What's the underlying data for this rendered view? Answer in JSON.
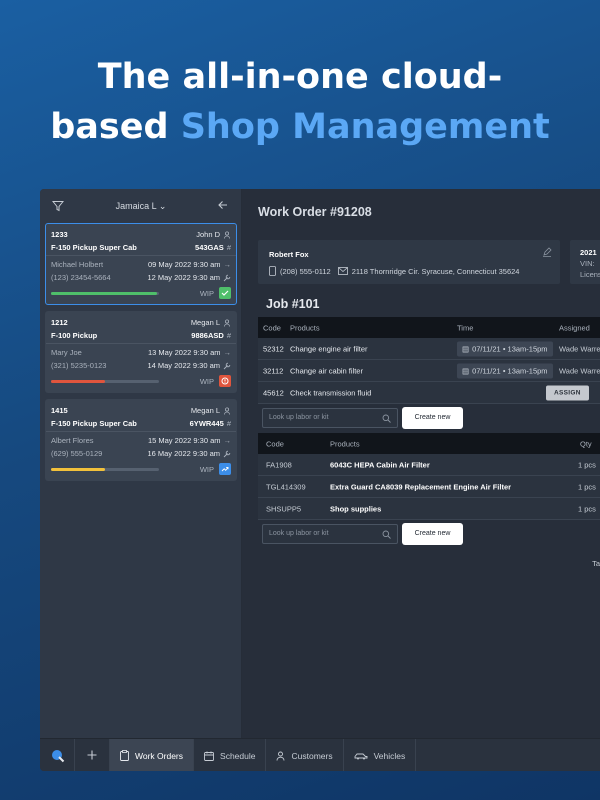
{
  "hero": {
    "line1": "The all-in-one cloud-",
    "line2_plain": "based ",
    "line2_accent": "Shop Management"
  },
  "colors": {
    "accent": "#5ba8f5",
    "selected_border": "#3c8ee9",
    "green": "#4fbf6a",
    "red": "#e0553d",
    "yellow": "#f2c13b",
    "blue": "#3c8ee9"
  },
  "sidebar": {
    "location": "Jamaica L",
    "cards": [
      {
        "code": "1233",
        "owner": "John D",
        "vehicle": "F-150 Pickup Super Cab",
        "plate": "543GAS",
        "contact": "Michael Holbert",
        "phone": "(123) 23454-5664",
        "date_in": "09 May 2022 9:30 am",
        "date_out": "12 May 2022 9:30 am",
        "status": "WIP",
        "progress": 0.98,
        "color": "green",
        "status_icon": "check-icon"
      },
      {
        "code": "1212",
        "owner": "Megan L",
        "vehicle": "F-100 Pickup",
        "plate": "9886ASD",
        "contact": "Mary Joe",
        "phone": "(321) 5235-0123",
        "date_in": "13 May 2022 9:30 am",
        "date_out": "14 May 2022 9:30 am",
        "status": "WIP",
        "progress": 0.5,
        "color": "red",
        "status_icon": "alert-icon"
      },
      {
        "code": "1415",
        "owner": "Megan L",
        "vehicle": "F-150 Pickup Super Cab",
        "plate": "6YWR445",
        "contact": "Albert Flores",
        "phone": "(629) 555-0129",
        "date_in": "15 May 2022 9:30 am",
        "date_out": "16 May 2022 9:30 am",
        "status": "WIP",
        "progress": 0.5,
        "color": "yellow",
        "status_icon": "trend-icon"
      }
    ]
  },
  "main": {
    "title": "Work Order #91208",
    "customer": {
      "name": "Robert Fox",
      "phone": "(208) 555-0112",
      "address": "2118 Thornridge Cir. Syracuse, Connecticut 35624"
    },
    "vehicle": {
      "year": "2021",
      "vin_label": "VIN:",
      "license_label": "Licens"
    },
    "job_title": "Job #101",
    "labor_table": {
      "headers": [
        "Code",
        "Products",
        "Time",
        "Assigned"
      ],
      "rows": [
        {
          "code": "52312",
          "product": "Change engine air filter",
          "time": "07/11/21 • 13am-15pm",
          "assigned": "Wade Warre"
        },
        {
          "code": "32112",
          "product": "Change air cabin filter",
          "time": "07/11/21 • 13am-15pm",
          "assigned": "Wade Warre"
        },
        {
          "code": "45612",
          "product": "Check transmission fluid",
          "time": "",
          "assigned": "ASSIGN"
        }
      ]
    },
    "lookup_placeholder": "Look up labor or kit",
    "create_label": "Create new",
    "parts_table": {
      "headers": [
        "Code",
        "Products",
        "Qty"
      ],
      "rows": [
        {
          "code": "FA1908",
          "product": "6043C HEPA Cabin Air Filter",
          "qty": "1 pcs"
        },
        {
          "code": "TGL414309",
          "product": "Extra Guard CA8039 Replacement Engine Air Filter",
          "qty": "1 pcs"
        },
        {
          "code": "SHSUPP5",
          "product": "Shop supplies",
          "qty": "1 pcs"
        }
      ]
    },
    "tax_label": "Ta"
  },
  "bottom_nav": {
    "tabs": [
      {
        "label": "Work Orders",
        "icon": "clipboard-icon",
        "active": true
      },
      {
        "label": "Schedule",
        "icon": "calendar-icon",
        "active": false
      },
      {
        "label": "Customers",
        "icon": "person-icon",
        "active": false
      },
      {
        "label": "Vehicles",
        "icon": "car-icon",
        "active": false
      }
    ]
  }
}
